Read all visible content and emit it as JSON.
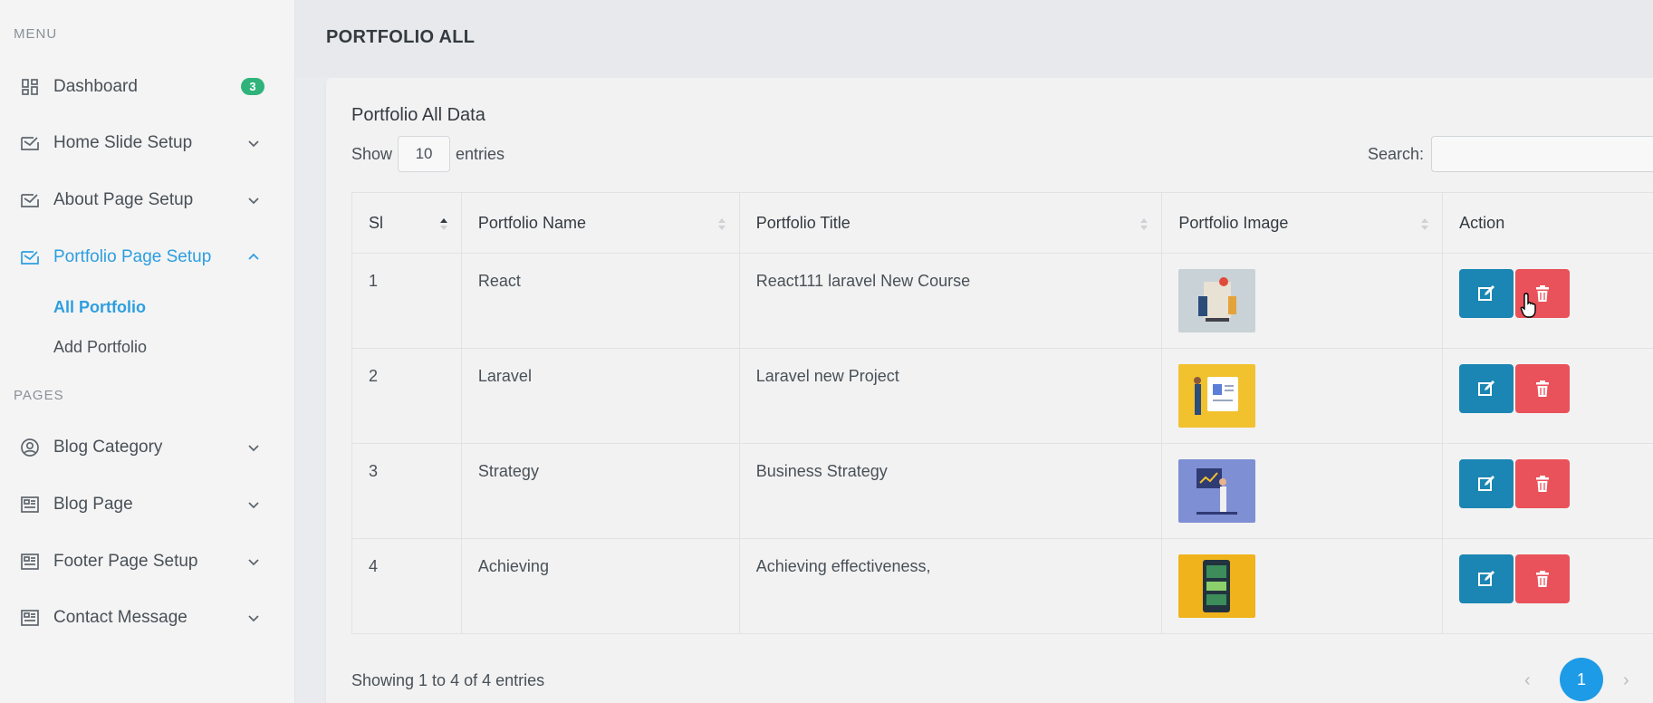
{
  "sidebar": {
    "menu_title": "MENU",
    "pages_title": "PAGES",
    "items": [
      {
        "label": "Dashboard",
        "icon": "dashboard-icon",
        "badge": "3"
      },
      {
        "label": "Home Slide Setup",
        "icon": "inbox-icon"
      },
      {
        "label": "About Page Setup",
        "icon": "inbox-icon"
      },
      {
        "label": "Portfolio Page Setup",
        "icon": "inbox-icon",
        "active": true,
        "children": [
          {
            "label": "All Portfolio",
            "active": true
          },
          {
            "label": "Add Portfolio"
          }
        ]
      },
      {
        "label": "Blog Category",
        "icon": "user-circle-icon"
      },
      {
        "label": "Blog Page",
        "icon": "newspaper-icon"
      },
      {
        "label": "Footer Page Setup",
        "icon": "newspaper-icon"
      },
      {
        "label": "Contact Message",
        "icon": "newspaper-icon"
      }
    ]
  },
  "header": {
    "title": "PORTFOLIO ALL"
  },
  "card": {
    "title": "Portfolio All Data",
    "show_label": "Show",
    "entries_value": "10",
    "entries_label": "entries",
    "search_label": "Search:",
    "search_value": ""
  },
  "table": {
    "columns": [
      "Sl",
      "Portfolio Name",
      "Portfolio Title",
      "Portfolio Image",
      "Action"
    ],
    "rows": [
      {
        "sl": "1",
        "name": "React",
        "title": "React111 laravel New Course",
        "image_color": "#c9d2d6"
      },
      {
        "sl": "2",
        "name": "Laravel",
        "title": "Laravel new Project",
        "image_color": "#f2c12e"
      },
      {
        "sl": "3",
        "name": "Strategy",
        "title": "Business Strategy",
        "image_color": "#7e8fd4"
      },
      {
        "sl": "4",
        "name": "Achieving",
        "title": "Achieving effectiveness,",
        "image_color": "#f0b31c"
      }
    ]
  },
  "footer": {
    "info": "Showing 1 to 4 of 4 entries",
    "prev": "‹",
    "current_page": "1",
    "next": "›"
  },
  "colors": {
    "accent": "#2d9ee0",
    "edit": "#1b86b3",
    "delete": "#e9525a",
    "badge": "#2fb37b"
  }
}
